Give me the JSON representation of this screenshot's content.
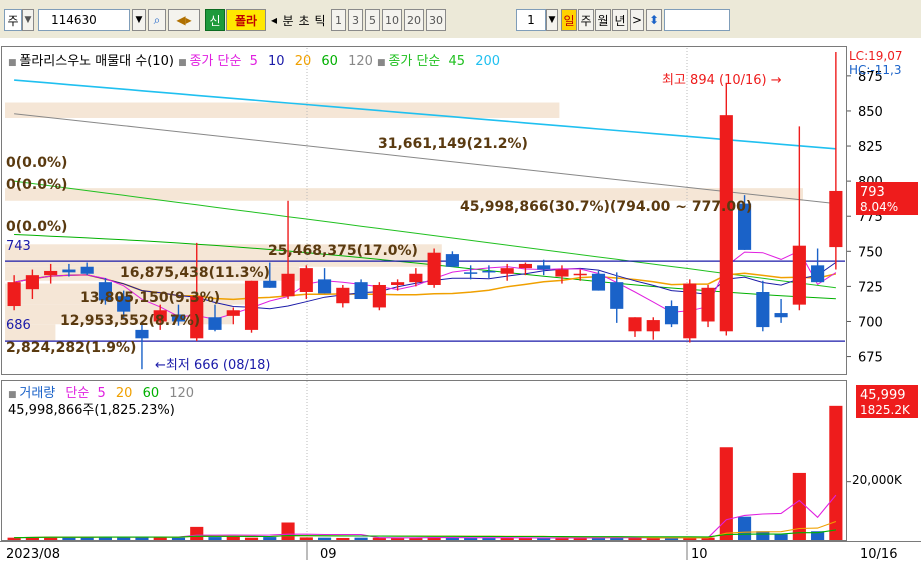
{
  "toolbar": {
    "market": "주",
    "code": "114630",
    "btn_sin": "신",
    "name": "폴라",
    "arrow_left": "◂",
    "labels": {
      "bun": "분",
      "cho": "초",
      "tick": "틱"
    },
    "periods": [
      "1",
      "3",
      "5",
      "10",
      "20",
      "30"
    ],
    "count": "1",
    "tf": {
      "day": "일",
      "week": "주",
      "month": "월",
      "year": "년"
    },
    "more": ">",
    "updown": "⬍"
  },
  "price_panel": {
    "title": "폴라리스우노 매물대 수(10)",
    "ma_label": "종가 단순",
    "ma_values": [
      "5",
      "10",
      "20",
      "60",
      "120"
    ],
    "ma2_label": "종가 단순",
    "ma2_values": [
      "45",
      "200"
    ],
    "lc": "LC:19,07",
    "hc": "HC:-11,3",
    "high_note": "최고 894 (10/16) →",
    "low_note": "←최저 666 (08/18)",
    "last_price": "793",
    "last_pct": "8.04%",
    "hline_upper": "743",
    "hline_lower": "686",
    "zero_labels": [
      "0(0.0%)",
      "0(0.0%)",
      "0(0.0%)"
    ],
    "vp_labels": [
      "31,661,149(21.2%)",
      "45,998,866(30.7%)(794.00 ~ 777.00)",
      "25,468,375(17.0%)",
      "16,875,438(11.3%)",
      "13,805,150(9.3%)",
      "12,953,552(8.7%)",
      "2,824,282(1.9%)"
    ]
  },
  "volume_panel": {
    "title": "거래량",
    "ma_label": "단순",
    "ma_values": [
      "5",
      "20",
      "60",
      "120"
    ],
    "info": "45,998,866주(1,825.23%)",
    "last_vol": "45,999",
    "last_pct": "1825.2K",
    "axis_label": "20,000K"
  },
  "xaxis": {
    "labels": [
      "2023/08",
      "09",
      "10"
    ],
    "right_label": "10/16"
  },
  "colors": {
    "up": "#ee1c1c",
    "down": "#1a62c8",
    "ma5": "#e020e0",
    "ma10": "#1a1aa8",
    "ma20": "#f0a000",
    "ma60": "#00b000",
    "ma120": "#888888",
    "ma45": "#20c020",
    "ma200": "#20c0f0",
    "profile": "#f5e6d6"
  },
  "chart_data": {
    "type": "candlestick",
    "ylim": [
      664,
      892
    ],
    "yticks": [
      675,
      700,
      725,
      750,
      775,
      800,
      825,
      850,
      875
    ],
    "candles": [
      {
        "o": 711,
        "h": 733,
        "l": 708,
        "c": 728
      },
      {
        "o": 723,
        "h": 737,
        "l": 716,
        "c": 733
      },
      {
        "o": 733,
        "h": 741,
        "l": 727,
        "c": 736
      },
      {
        "o": 737,
        "h": 741,
        "l": 732,
        "c": 735
      },
      {
        "o": 739,
        "h": 742,
        "l": 733,
        "c": 734
      },
      {
        "o": 728,
        "h": 731,
        "l": 712,
        "c": 715
      },
      {
        "o": 718,
        "h": 722,
        "l": 702,
        "c": 707
      },
      {
        "o": 694,
        "h": 700,
        "l": 666,
        "c": 688
      },
      {
        "o": 700,
        "h": 712,
        "l": 694,
        "c": 708
      },
      {
        "o": 705,
        "h": 712,
        "l": 697,
        "c": 700
      },
      {
        "o": 688,
        "h": 756,
        "l": 686,
        "c": 718
      },
      {
        "o": 703,
        "h": 712,
        "l": 693,
        "c": 694
      },
      {
        "o": 704,
        "h": 710,
        "l": 698,
        "c": 708
      },
      {
        "o": 694,
        "h": 729,
        "l": 692,
        "c": 729
      },
      {
        "o": 729,
        "h": 742,
        "l": 724,
        "c": 724
      },
      {
        "o": 718,
        "h": 786,
        "l": 716,
        "c": 734
      },
      {
        "o": 721,
        "h": 740,
        "l": 716,
        "c": 738
      },
      {
        "o": 730,
        "h": 738,
        "l": 720,
        "c": 720
      },
      {
        "o": 713,
        "h": 726,
        "l": 710,
        "c": 724
      },
      {
        "o": 728,
        "h": 730,
        "l": 716,
        "c": 716
      },
      {
        "o": 710,
        "h": 728,
        "l": 708,
        "c": 726
      },
      {
        "o": 726,
        "h": 730,
        "l": 722,
        "c": 728
      },
      {
        "o": 728,
        "h": 738,
        "l": 725,
        "c": 734
      },
      {
        "o": 726,
        "h": 752,
        "l": 724,
        "c": 749
      },
      {
        "o": 748,
        "h": 750,
        "l": 739,
        "c": 739
      },
      {
        "o": 735,
        "h": 740,
        "l": 730,
        "c": 734
      },
      {
        "o": 736,
        "h": 740,
        "l": 731,
        "c": 735
      },
      {
        "o": 734,
        "h": 741,
        "l": 729,
        "c": 738
      },
      {
        "o": 738,
        "h": 742,
        "l": 733,
        "c": 741
      },
      {
        "o": 740,
        "h": 744,
        "l": 733,
        "c": 737
      },
      {
        "o": 732,
        "h": 740,
        "l": 727,
        "c": 737
      },
      {
        "o": 734,
        "h": 737,
        "l": 729,
        "c": 734
      },
      {
        "o": 734,
        "h": 736,
        "l": 722,
        "c": 722
      },
      {
        "o": 728,
        "h": 735,
        "l": 699,
        "c": 709
      },
      {
        "o": 693,
        "h": 703,
        "l": 689,
        "c": 703
      },
      {
        "o": 693,
        "h": 703,
        "l": 687,
        "c": 701
      },
      {
        "o": 711,
        "h": 715,
        "l": 696,
        "c": 698
      },
      {
        "o": 688,
        "h": 730,
        "l": 685,
        "c": 727
      },
      {
        "o": 700,
        "h": 726,
        "l": 696,
        "c": 724
      },
      {
        "o": 693,
        "h": 870,
        "l": 690,
        "c": 847
      },
      {
        "o": 784,
        "h": 790,
        "l": 751,
        "c": 751
      },
      {
        "o": 721,
        "h": 729,
        "l": 693,
        "c": 696
      },
      {
        "o": 706,
        "h": 716,
        "l": 699,
        "c": 703
      },
      {
        "o": 712,
        "h": 839,
        "l": 708,
        "c": 754
      },
      {
        "o": 740,
        "h": 752,
        "l": 730,
        "c": 728
      },
      {
        "o": 753,
        "h": 892,
        "l": 737,
        "c": 793
      }
    ],
    "hlines": [
      743,
      686
    ],
    "volume": {
      "ylim": [
        0,
        48000
      ],
      "yticks": [
        20000
      ],
      "unit": "K",
      "values": [
        800,
        1000,
        1100,
        900,
        1000,
        1200,
        1000,
        900,
        1000,
        800,
        4500,
        1000,
        1200,
        800,
        1000,
        6000,
        900,
        800,
        700,
        800,
        800,
        700,
        800,
        1000,
        800,
        700,
        700,
        700,
        800,
        700,
        700,
        700,
        800,
        1000,
        700,
        600,
        700,
        900,
        800,
        31800,
        8000,
        3000,
        2000,
        23000,
        3000,
        46000
      ]
    }
  }
}
